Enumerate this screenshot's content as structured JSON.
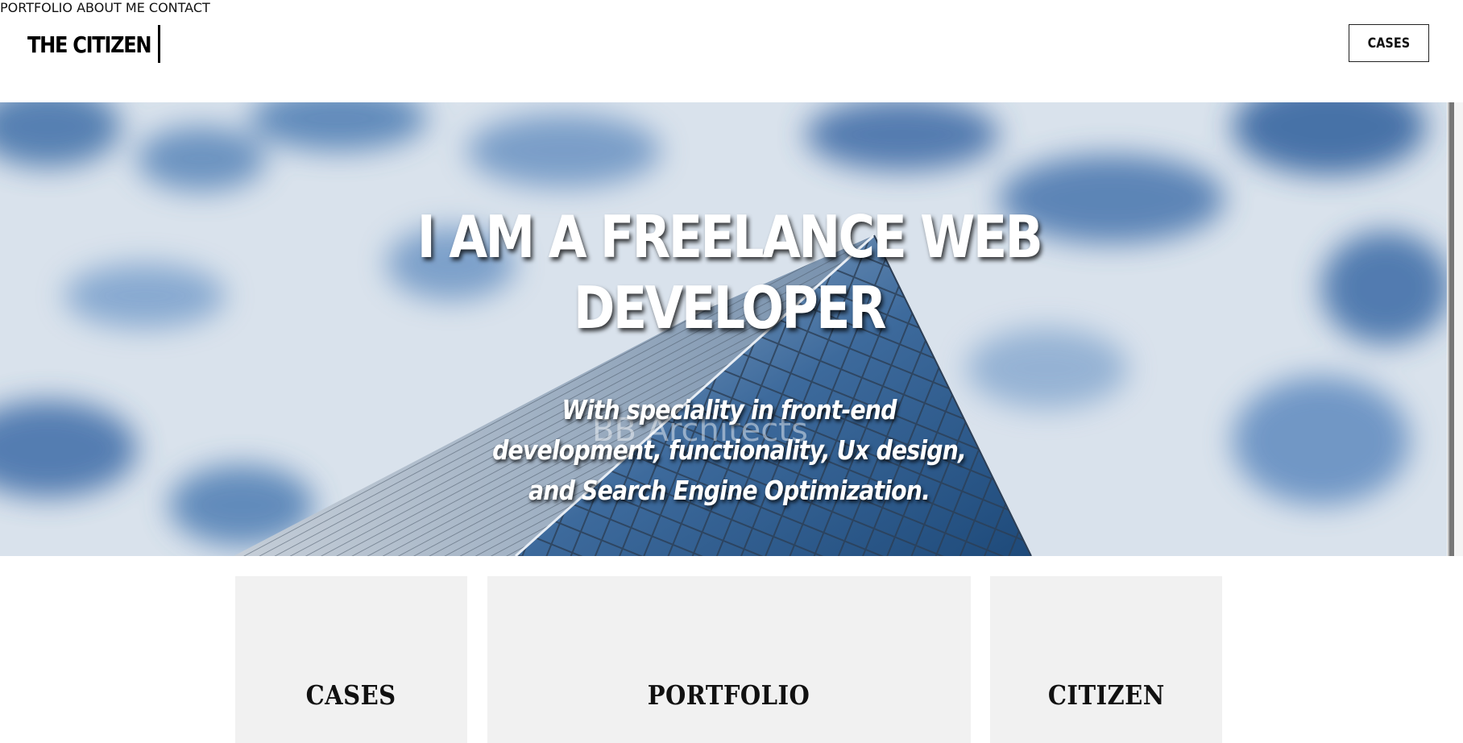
{
  "header": {
    "brand": "THE CITIZEN",
    "nav": [
      {
        "label": "PORTFOLIO"
      },
      {
        "label": "ABOUT ME"
      },
      {
        "label": "CONTACT"
      }
    ],
    "cta_label": "CASES"
  },
  "hero": {
    "title_line1": "I AM A FREELANCE WEB",
    "title_line2": "DEVELOPER",
    "subtitle": "With speciality in front-end development, functionality, Ux design, and Search Engine Optimization.",
    "background_sign": "BB Architects"
  },
  "cards": [
    {
      "label": "CASES"
    },
    {
      "label": "PORTFOLIO"
    },
    {
      "label": "CITIZEN"
    }
  ],
  "colors": {
    "text": "#111111",
    "card_bg": "#f1f1f1",
    "sky": "#4f7fb8",
    "hero_text": "#ffffff"
  }
}
